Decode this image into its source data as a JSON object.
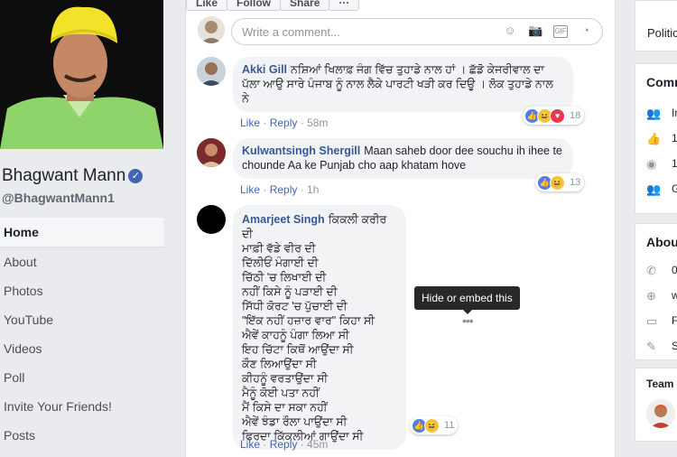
{
  "sidebar": {
    "page_name": "Bhagwant Mann",
    "handle": "@BhagwantMann1",
    "nav": [
      "Home",
      "About",
      "Photos",
      "YouTube",
      "Videos",
      "Poll",
      "Invite Your Friends!",
      "Posts"
    ]
  },
  "post_actions": [
    "Like",
    "Follow",
    "Share",
    "···"
  ],
  "composer": {
    "placeholder": "Write a comment..."
  },
  "comments": [
    {
      "author": "Akki Gill",
      "text": "ਨਸ਼ਿਆਂ ਖਿਲਾਫ਼ ਜੰਗ ਵਿੱਚ ਤੁਹਾਡੇ ਨਾਲ ਹਾਂ । ਛੱਡੋ ਕੇਜਰੀਵਾਲ ਦਾ ਪੱਲਾ ਆਉ ਸਾਰੇ ਪੰਜਾਬ ਨੂੰ ਨਾਲ ਲੈਕੇ ਪਾਰਟੀ ਖੜੀ ਕਰ ਦਿਊ । ਲੋਕ ਤੁਹਾਡੇ ਨਾਲ ਨੇ",
      "like": "Like",
      "reply": "Reply",
      "time": "58m",
      "reactions": "18"
    },
    {
      "author": "Kulwantsingh Shergill",
      "text": "Maan saheb door dee souchu ih ihee te chounde Aa ke Punjab cho aap khatam hove",
      "like": "Like",
      "reply": "Reply",
      "time": "1h",
      "reactions": "13"
    },
    {
      "author": "Amarjeet Singh",
      "lines": [
        "ਕਿਕਲੀ ਕਰੀਰ ਦੀ",
        "ਮਾਫ਼ੀ ਵੱਡੇ ਵੀਰ ਦੀ",
        "ਦਿੱਲੀਓਂ ਮੰਗਾਈ ਦੀ",
        "ਚਿੱਠੀ 'ਚ ਲਿਖਾਈ ਦੀ",
        "ਨਹੀਂ ਕਿਸੇ ਨੂੰ ਪੜਾਈ ਦੀ",
        "ਸਿੱਧੀ ਕੋਰਟ 'ਚ ਪੁੱਚਾਈ ਦੀ",
        "\"ਇੱਕ ਨਹੀਂ ਹਜ਼ਾਰ ਵਾਰ\" ਕਿਹਾ ਸੀ",
        "ਐਵੇਂ ਕਾਹਨੂੰ ਪੰਗਾ ਲਿਆ ਸੀ",
        "ਇਹ ਚਿੱਟਾ ਕਿਥੋਂ ਆਉਂਦਾ ਸੀ",
        "ਕੌਣ ਲਿਆਉਂਦਾ ਸੀ",
        "ਕੀਹਨੂੰ ਵਰਤਾਉਂਦਾ ਸੀ",
        "ਮੈਨੂੰ ਕੋਈ ਪਤਾ ਨਹੀਂ",
        "ਮੈਂ ਕਿਸੇ ਦਾ ਸਕਾ ਨਹੀਂ",
        "ਐਵੇਂ ਝੰਡਾ ਰੌਲਾ ਪਾਉਂਦਾ ਸੀ",
        "ਫਿਰਦਾ ਕਿੱਕਲੀਆਂ ਗਾਉਂਦਾ ਸੀ"
      ],
      "like": "Like",
      "reply": "Reply",
      "time": "45m",
      "reactions": "11"
    }
  ],
  "tooltip": "Hide or embed this",
  "right": {
    "politics": "Politic",
    "community_title": "Comm",
    "community_rows": [
      "In",
      "1",
      "1",
      "G"
    ],
    "about_title": "Abou",
    "about_rows": [
      "0",
      "w",
      "F",
      "S"
    ],
    "team_title": "Team"
  },
  "colors": {
    "link": "#385898",
    "page_bg": "#e9ebee",
    "verified": "#4267b2"
  }
}
